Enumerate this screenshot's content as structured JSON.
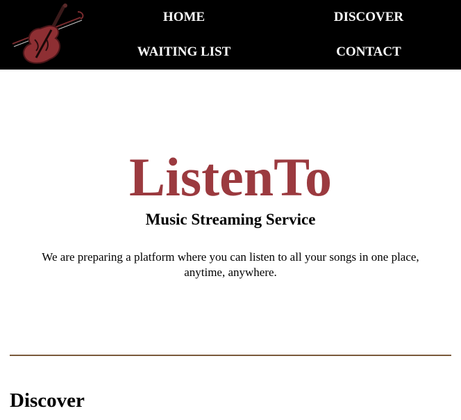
{
  "header": {
    "logo_icon": "violin-icon",
    "nav": {
      "home": "HOME",
      "discover": "DISCOVER",
      "waiting_list": "WAITING LIST",
      "contact": "CONTACT"
    }
  },
  "hero": {
    "title": "ListenTo",
    "subtitle": "Music Streaming Service",
    "description": "We are preparing a platform where you can listen to all your songs in one place, anytime, anywhere."
  },
  "section": {
    "heading": "Discover"
  },
  "colors": {
    "header_bg": "#000000",
    "brand_red": "#9b3a3f",
    "divider": "#7a5a3a"
  }
}
